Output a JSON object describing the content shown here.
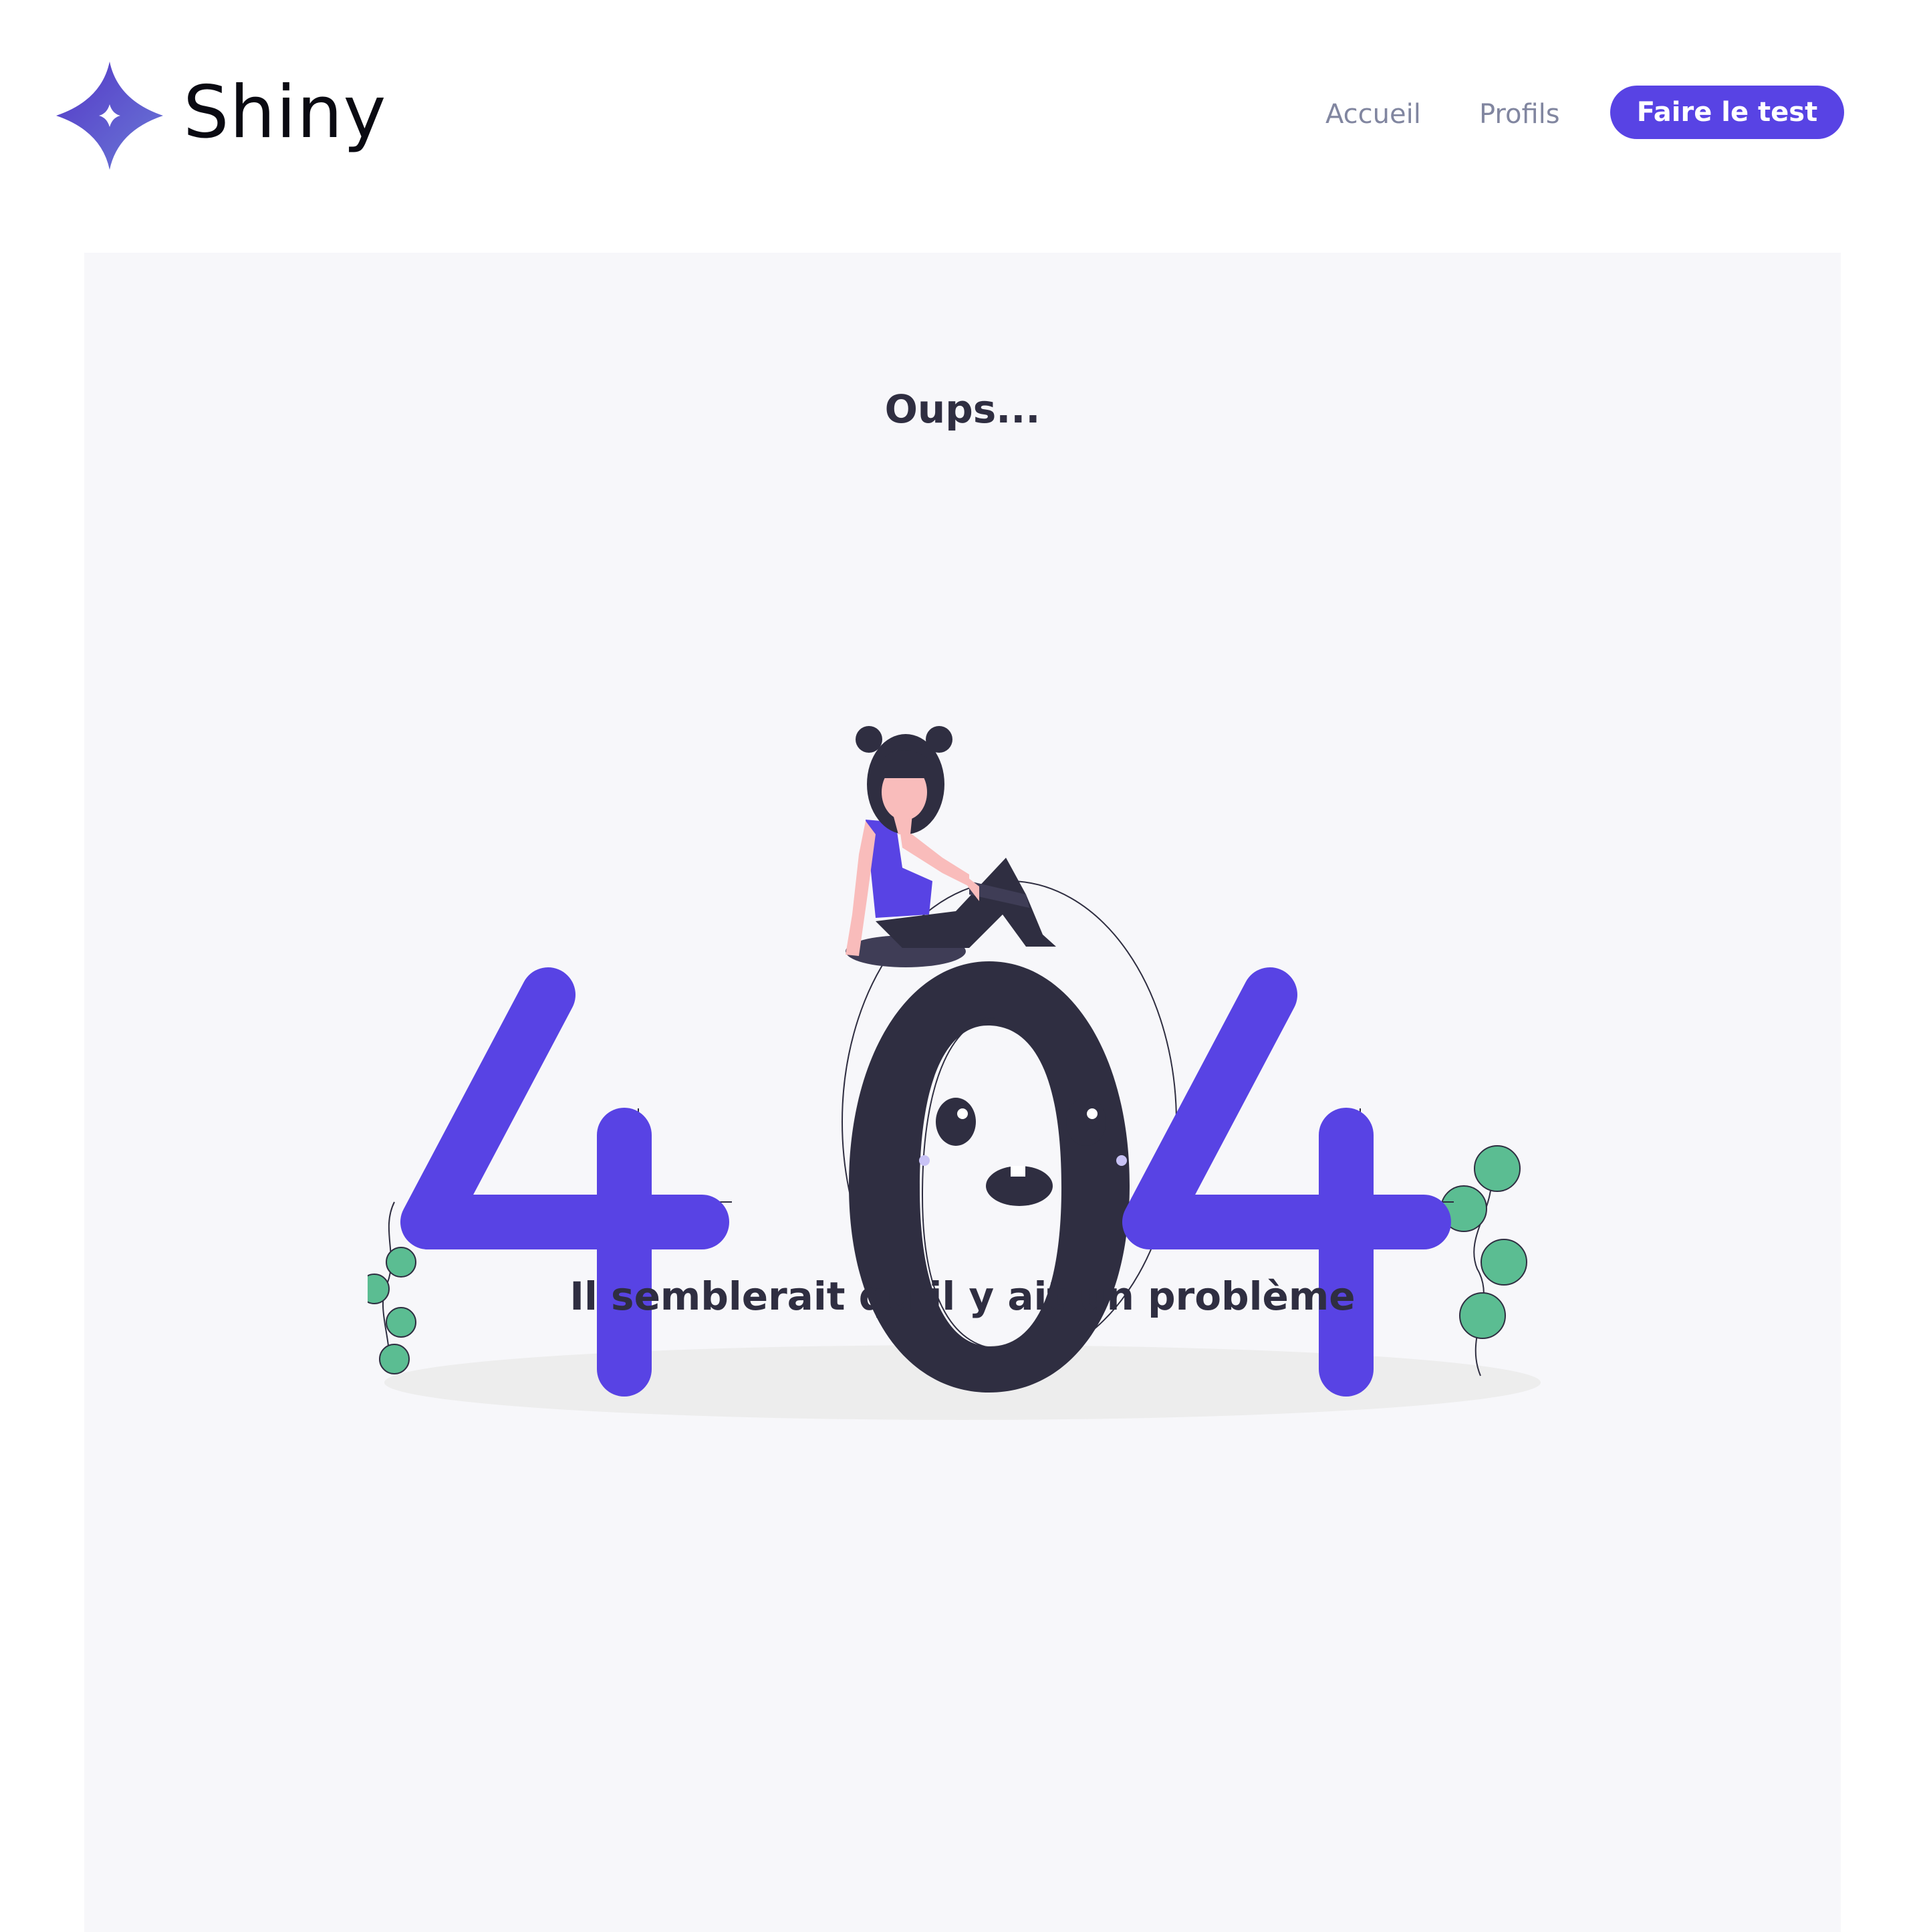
{
  "header": {
    "brand": "Shiny",
    "nav": {
      "home": "Accueil",
      "profiles": "Profils",
      "test": "Faire le test"
    }
  },
  "main": {
    "title": "Oups...",
    "illustration": {
      "text": "404"
    },
    "message": "Il semblerait qu’il y ait un problème"
  },
  "colors": {
    "accent": "#5843E4",
    "dark": "#2F2E41",
    "nav_text": "#8186A0",
    "panel_bg": "#F7F7FA",
    "leaf": "#5BBD92"
  },
  "icons": {
    "logo": "sparkle-star-icon"
  }
}
